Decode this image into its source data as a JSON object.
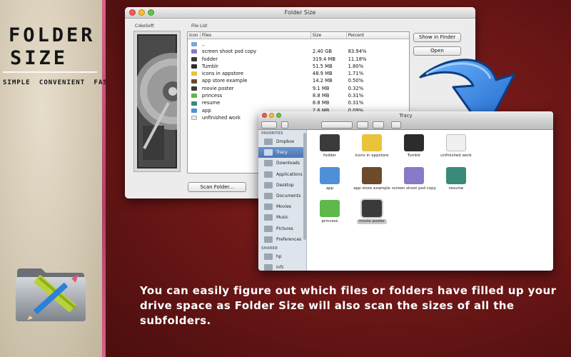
{
  "branding": {
    "title_line1": "FOLDER",
    "title_line2": "SIZE",
    "tagline": "SIMPLE CONVENIENT FAST"
  },
  "main_window": {
    "title": "Folder Size",
    "left_label": "CokeSoft",
    "list_label": "File List",
    "columns": [
      "Icon",
      "Files",
      "Size",
      "Percent"
    ],
    "rows": [
      {
        "icon": "parent-folder-icon",
        "name": "..",
        "size": "",
        "percent": ""
      },
      {
        "icon": "folder-icon",
        "name": "screen shoot psd copy",
        "size": "2.40 GB",
        "percent": "83.94%"
      },
      {
        "icon": "folder-icon",
        "name": "fodder",
        "size": "319.4 MB",
        "percent": "11.18%"
      },
      {
        "icon": "folder-icon",
        "name": "Tumblr",
        "size": "51.5 MB",
        "percent": "1.80%"
      },
      {
        "icon": "folder-icon",
        "name": "icons in appstore",
        "size": "48.9 MB",
        "percent": "1.71%"
      },
      {
        "icon": "folder-icon",
        "name": "app store example",
        "size": "14.2 MB",
        "percent": "0.50%"
      },
      {
        "icon": "folder-icon",
        "name": "movie poster",
        "size": "9.1 MB",
        "percent": "0.32%"
      },
      {
        "icon": "folder-icon",
        "name": "princess",
        "size": "8.8 MB",
        "percent": "0.31%"
      },
      {
        "icon": "folder-icon",
        "name": "resume",
        "size": "8.8 MB",
        "percent": "0.31%"
      },
      {
        "icon": "folder-icon",
        "name": "app",
        "size": "2.6 MB",
        "percent": "0.09%"
      },
      {
        "icon": "document-icon",
        "name": "unfinished work",
        "size": "",
        "percent": ""
      }
    ],
    "buttons": {
      "show_in_finder": "Show in Finder",
      "open": "Open",
      "scan_folder": "Scan Folder..."
    }
  },
  "finder_window": {
    "title": "Tracy",
    "sidebar": {
      "favorites_header": "FAVORITES",
      "favorites": [
        "Dropbox",
        "Tracy",
        "Downloads",
        "Applications",
        "Desktop",
        "Documents",
        "Movies",
        "Music",
        "Pictures",
        "Preferences"
      ],
      "selected": "Tracy",
      "shared_header": "SHARED",
      "shared": [
        "hp",
        "infc"
      ]
    },
    "items": [
      {
        "label": "fodder",
        "icon": "fodder-folder-icon",
        "color": "#3b3b3b"
      },
      {
        "label": "icons in appstore",
        "icon": "penguin-folder-icon",
        "color": "#e9c33a"
      },
      {
        "label": "Tumblr",
        "icon": "camera-folder-icon",
        "color": "#2c2c2c"
      },
      {
        "label": "unfinished work",
        "icon": "document-folder-icon",
        "color": "#f0f0f0"
      },
      {
        "label": "app",
        "icon": "safari-folder-icon",
        "color": "#4f8fd8"
      },
      {
        "label": "app store example",
        "icon": "horse-folder-icon",
        "color": "#6d4a2a"
      },
      {
        "label": "screen shoot psd copy",
        "icon": "boxes-folder-icon",
        "color": "#8a78c8"
      },
      {
        "label": "resume",
        "icon": "globe-folder-icon",
        "color": "#3a8a7a"
      },
      {
        "label": "princess",
        "icon": "green-folder-icon",
        "color": "#5fb84a"
      },
      {
        "label": "movie poster",
        "icon": "clapper-folder-icon",
        "color": "#3a3a3a"
      }
    ],
    "selected_item": "movie poster"
  },
  "caption": "You can easily figure out which files or folders have filled up your drive space as Folder Size will also scan the sizes of all the subfolders.",
  "colors": {
    "accent_blue": "#2f86e0",
    "background_red": "#6a1616",
    "parchment": "#d3c8b2"
  }
}
